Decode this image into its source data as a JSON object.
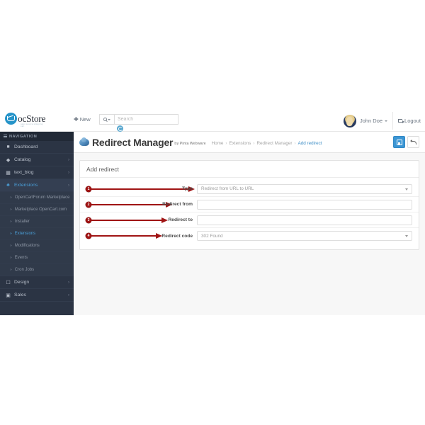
{
  "topbar": {
    "brand": {
      "oc": "oc",
      "store": "Store",
      "tagline": "open source shopping cart"
    },
    "new_label": "New",
    "search": {
      "placeholder": "Search",
      "value": ""
    },
    "user_name": "John Doe",
    "logout_label": "Logout"
  },
  "sidebar": {
    "title": "NAVIGATION",
    "items": [
      {
        "label": "Dashboard",
        "icon": "dashboard-icon",
        "has_chevron": false,
        "active": false,
        "sub": false
      },
      {
        "label": "Catalog",
        "icon": "tag-icon",
        "has_chevron": true,
        "active": false,
        "sub": false
      },
      {
        "label": "text_blog",
        "icon": "book-icon",
        "has_chevron": true,
        "active": false,
        "sub": false
      },
      {
        "label": "Extensions",
        "icon": "puzzle-icon",
        "has_chevron": true,
        "active": true,
        "sub": false
      },
      {
        "label": "OpenCartForum Marketplace",
        "icon": "",
        "has_chevron": false,
        "active": false,
        "sub": true
      },
      {
        "label": "Marketplace OpenCart.com",
        "icon": "",
        "has_chevron": false,
        "active": false,
        "sub": true
      },
      {
        "label": "Installer",
        "icon": "",
        "has_chevron": false,
        "active": false,
        "sub": true
      },
      {
        "label": "Extensions",
        "icon": "",
        "has_chevron": false,
        "active": true,
        "sub": true
      },
      {
        "label": "Modifications",
        "icon": "",
        "has_chevron": false,
        "active": false,
        "sub": true
      },
      {
        "label": "Events",
        "icon": "",
        "has_chevron": false,
        "active": false,
        "sub": true
      },
      {
        "label": "Cron Jobs",
        "icon": "",
        "has_chevron": false,
        "active": false,
        "sub": true
      },
      {
        "label": "Design",
        "icon": "monitor-icon",
        "has_chevron": true,
        "active": false,
        "sub": false
      },
      {
        "label": "Sales",
        "icon": "cart-icon",
        "has_chevron": true,
        "active": false,
        "sub": false
      }
    ]
  },
  "page": {
    "title": "Redirect Manager",
    "byline": "by Pinta Webware",
    "breadcrumbs": [
      "Home",
      "Extensions",
      "Redirect Manager",
      "Add redirect"
    ],
    "save_button": "save-button",
    "back_button": "back-button"
  },
  "panel": {
    "heading": "Add redirect",
    "fields": [
      {
        "num": "1",
        "label": "Type",
        "type": "select",
        "value": "Redirect from URL to URL",
        "placeholder": ""
      },
      {
        "num": "2",
        "label": "Redirect from",
        "type": "text",
        "value": "",
        "placeholder": ""
      },
      {
        "num": "3",
        "label": "Redirect to",
        "type": "text",
        "value": "",
        "placeholder": ""
      },
      {
        "num": "4",
        "label": "Redirect code",
        "type": "select",
        "value": "302 Found",
        "placeholder": ""
      }
    ]
  },
  "colors": {
    "sidebar_bg": "#2b3444",
    "sidebar_sub_bg": "#303a4a",
    "accent_blue": "#3c96d4",
    "link_blue": "#4a9fd8",
    "annotation_red": "#a01414",
    "page_bg": "#f7f7f7"
  }
}
